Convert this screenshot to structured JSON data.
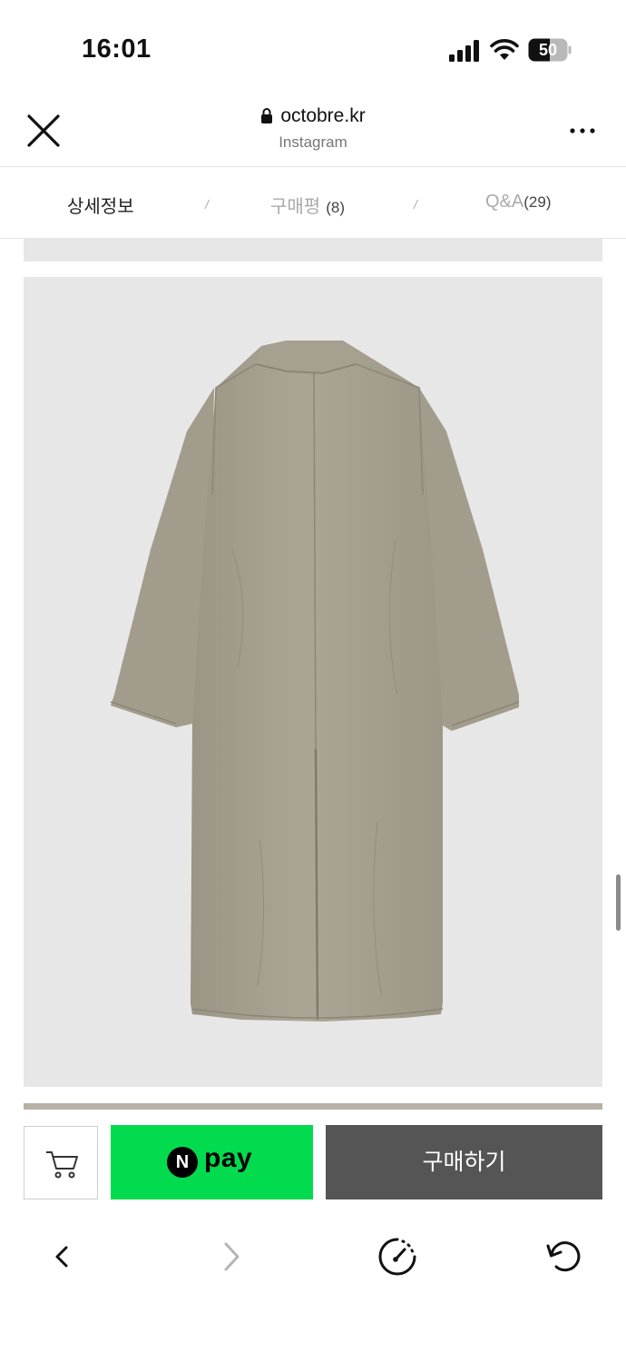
{
  "status_bar": {
    "time": "16:01",
    "battery": "50"
  },
  "browser": {
    "domain": "octobre.kr",
    "source": "Instagram"
  },
  "tabs": [
    {
      "label": "상세정보",
      "count": ""
    },
    {
      "label": "구매평",
      "count": "(8)"
    },
    {
      "label": "Q&A",
      "count": "(29)"
    }
  ],
  "tab_separator": "/",
  "product": {
    "image": "coat-back-view-icon"
  },
  "purchase": {
    "cart_icon": "cart-icon",
    "npay_mark": "N",
    "npay_label": "pay",
    "buy_label": "구매하기"
  },
  "toolbar": {
    "items": [
      "back-icon",
      "forward-icon",
      "speedometer-icon",
      "reload-icon"
    ]
  },
  "colors": {
    "npay_green": "#03db4f",
    "buy_gray": "#555555",
    "coat": "#a8a292",
    "image_bg": "#e7e7e7"
  }
}
